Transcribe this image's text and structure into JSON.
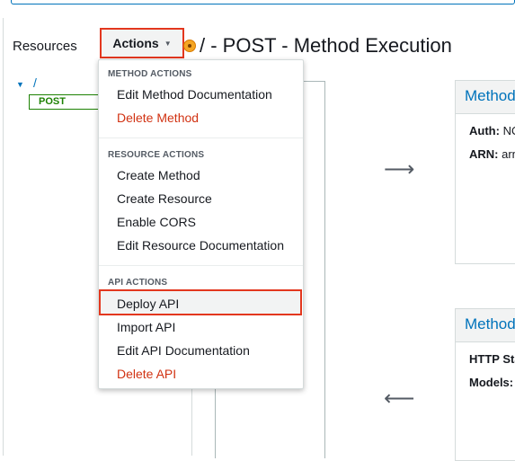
{
  "header": {
    "resources_label": "Resources",
    "actions_label": "Actions",
    "page_title": "/ - POST - Method Execution"
  },
  "tree": {
    "root": "/",
    "child": "POST"
  },
  "cards": [
    {
      "title": "Method Request",
      "rows": [
        {
          "label": "Auth:",
          "value": "NONE"
        },
        {
          "label": "ARN:",
          "value": "arn"
        }
      ]
    },
    {
      "title": "Method Response",
      "rows": [
        {
          "label": "HTTP Status:",
          "value": ""
        },
        {
          "label": "Models:",
          "value": ""
        }
      ]
    }
  ],
  "menu": {
    "method_actions": {
      "header": "METHOD ACTIONS",
      "items": [
        "Edit Method Documentation",
        "Delete Method"
      ]
    },
    "resource_actions": {
      "header": "RESOURCE ACTIONS",
      "items": [
        "Create Method",
        "Create Resource",
        "Enable CORS",
        "Edit Resource Documentation"
      ]
    },
    "api_actions": {
      "header": "API ACTIONS",
      "items": [
        "Deploy API",
        "Import API",
        "Edit API Documentation",
        "Delete API"
      ]
    }
  },
  "colors": {
    "accent": "#0073bb",
    "danger": "#d13212",
    "highlight_border": "#e3371e",
    "post_green": "#1d8102"
  }
}
